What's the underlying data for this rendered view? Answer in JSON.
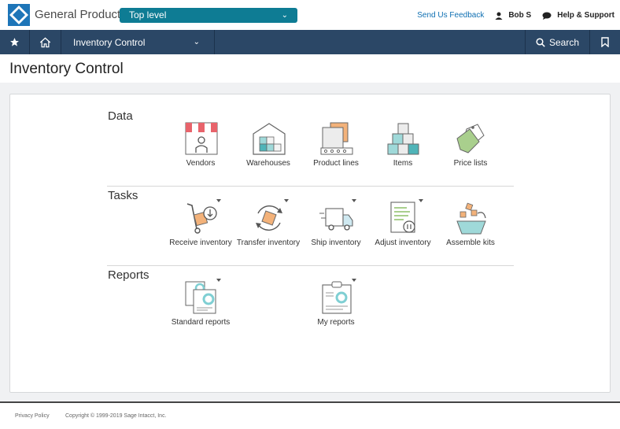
{
  "header": {
    "company": "General Product",
    "entity": "Top level",
    "feedback": "Send Us Feedback",
    "user": "Bob S",
    "help": "Help & Support"
  },
  "nav": {
    "module": "Inventory Control",
    "search": "Search"
  },
  "page": {
    "title": "Inventory Control"
  },
  "sections": {
    "data": {
      "label": "Data",
      "items": [
        "Vendors",
        "Warehouses",
        "Product lines",
        "Items",
        "Price lists"
      ]
    },
    "tasks": {
      "label": "Tasks",
      "items": [
        "Receive inventory",
        "Transfer inventory",
        "Ship inventory",
        "Adjust inventory",
        "Assemble kits"
      ]
    },
    "reports": {
      "label": "Reports",
      "items": [
        "Standard reports",
        "My reports"
      ]
    }
  },
  "footer": {
    "privacy": "Privacy Policy",
    "copyright": "Copyright © 1999-2019 Sage Intacct, Inc."
  },
  "colors": {
    "navbar": "#2b4766",
    "entity_select": "#0e7c94",
    "link": "#0e6fb2",
    "icon_teal": "#7fcfd3",
    "icon_orange": "#f3b27a",
    "icon_red": "#e8636b"
  },
  "icons": {
    "star": "star-icon",
    "home": "home-icon",
    "search": "search-icon",
    "bookmark": "bookmark-icon",
    "user": "user-icon",
    "chat": "chat-icon"
  }
}
